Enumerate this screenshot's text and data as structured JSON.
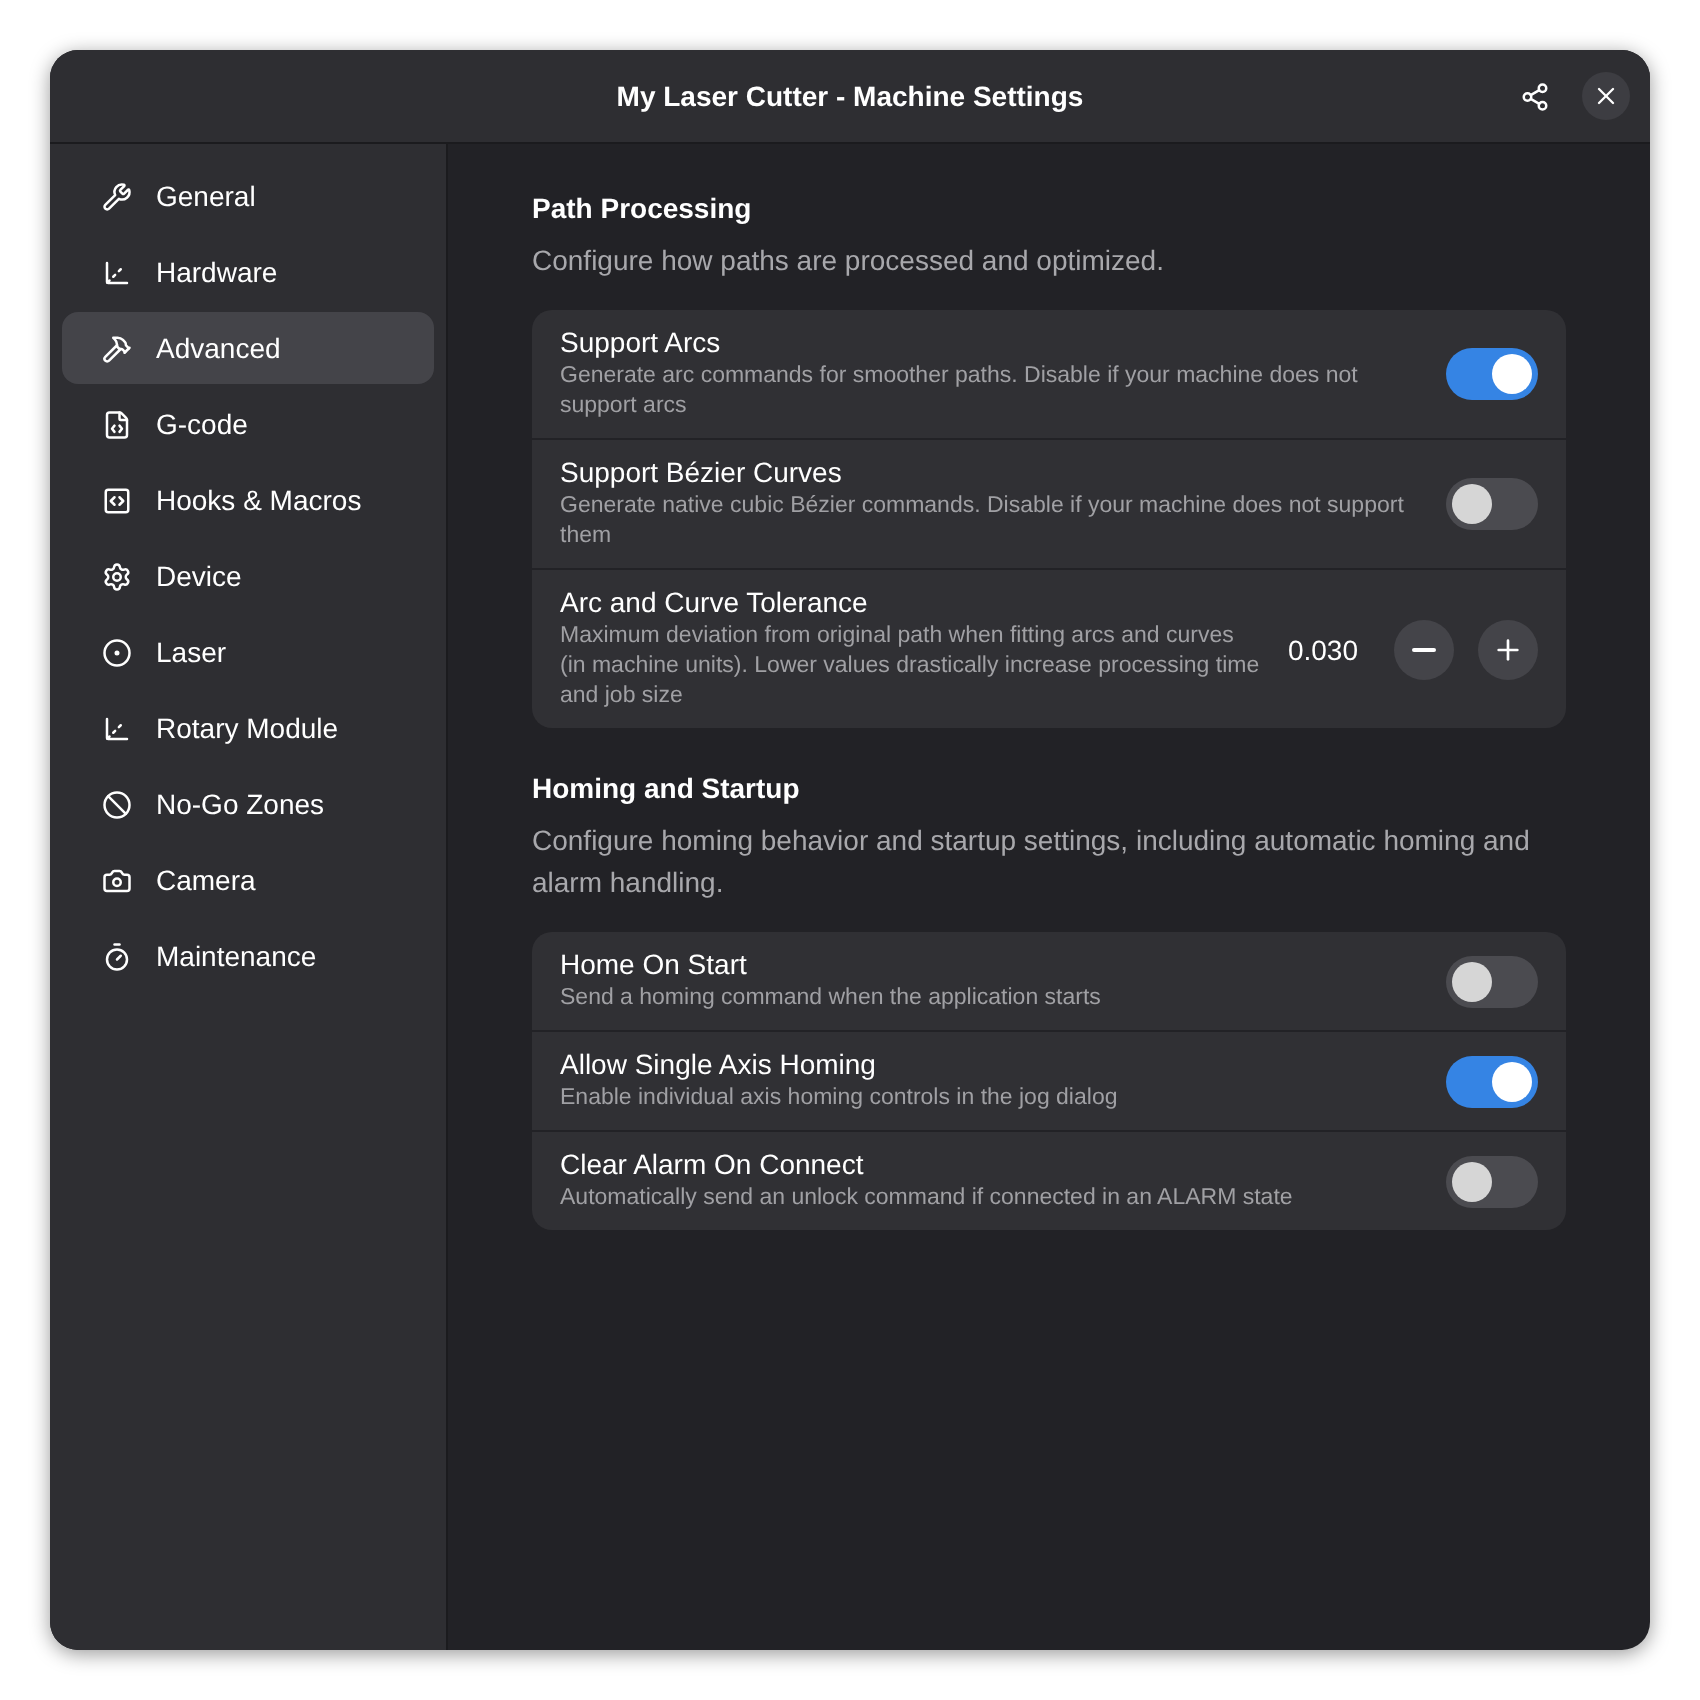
{
  "window": {
    "title": "My Laser Cutter - Machine Settings"
  },
  "sidebar": {
    "items": [
      {
        "label": "General",
        "selected": false
      },
      {
        "label": "Hardware",
        "selected": false
      },
      {
        "label": "Advanced",
        "selected": true
      },
      {
        "label": "G-code",
        "selected": false
      },
      {
        "label": "Hooks & Macros",
        "selected": false
      },
      {
        "label": "Device",
        "selected": false
      },
      {
        "label": "Laser",
        "selected": false
      },
      {
        "label": "Rotary Module",
        "selected": false
      },
      {
        "label": "No-Go Zones",
        "selected": false
      },
      {
        "label": "Camera",
        "selected": false
      },
      {
        "label": "Maintenance",
        "selected": false
      }
    ]
  },
  "sections": [
    {
      "title": "Path Processing",
      "description": "Configure how paths are processed and optimized.",
      "rows": [
        {
          "kind": "switch",
          "title": "Support Arcs",
          "description": "Generate arc commands for smoother paths. Disable if your machine does not support arcs",
          "on": true
        },
        {
          "kind": "switch",
          "title": "Support Bézier Curves",
          "description": "Generate native cubic Bézier commands. Disable if your machine does not support them",
          "on": false
        },
        {
          "kind": "spin",
          "title": "Arc and Curve Tolerance",
          "description": "Maximum deviation from original path when fitting arcs and curves (in machine units). Lower values drastically increase processing time and job size",
          "value": "0.030"
        }
      ]
    },
    {
      "title": "Homing and Startup",
      "description": "Configure homing behavior and startup settings, including automatic homing and alarm handling.",
      "rows": [
        {
          "kind": "switch",
          "title": "Home On Start",
          "description": "Send a homing command when the application starts",
          "on": false
        },
        {
          "kind": "switch",
          "title": "Allow Single Axis Homing",
          "description": "Enable individual axis homing controls in the jog dialog",
          "on": true
        },
        {
          "kind": "switch",
          "title": "Clear Alarm On Connect",
          "description": "Automatically send an unlock command if connected in an ALARM state",
          "on": false
        }
      ]
    }
  ]
}
